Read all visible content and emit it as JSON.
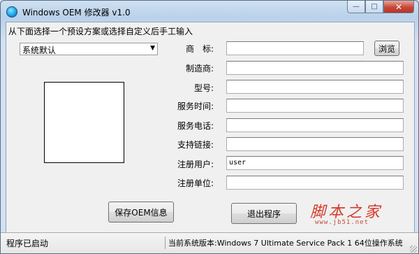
{
  "window": {
    "title": "Windows OEM 修改器 v1.0",
    "minimize_icon": "minimize-icon",
    "maximize_icon": "maximize-icon",
    "close_icon": "close-icon",
    "minimize_glyph": "—",
    "maximize_glyph": "□",
    "close_glyph": "✕"
  },
  "instruction": "从下面选择一个预设方案或选择自定义后手工输入",
  "preset": {
    "selected": "系统默认",
    "arrow_glyph": "▼"
  },
  "fields": [
    {
      "label": "商　标:",
      "value": ""
    },
    {
      "label": "制造商:",
      "value": ""
    },
    {
      "label": "型号:",
      "value": ""
    },
    {
      "label": "服务时间:",
      "value": ""
    },
    {
      "label": "服务电话:",
      "value": ""
    },
    {
      "label": "支持链接:",
      "value": ""
    },
    {
      "label": "注册用户:",
      "value": "user"
    },
    {
      "label": "注册单位:",
      "value": ""
    }
  ],
  "buttons": {
    "browse": "浏览",
    "save": "保存OEM信息",
    "exit": "退出程序"
  },
  "watermark": {
    "brand": "脚本之家",
    "url": "www.jb51.net"
  },
  "status": {
    "left": "程序已启动",
    "right": "当前系统版本:Windows 7 Ultimate Service Pack 1 64位操作系统"
  },
  "colors": {
    "accent_title": "#b9d1ea",
    "watermark": "#d63a2a"
  }
}
